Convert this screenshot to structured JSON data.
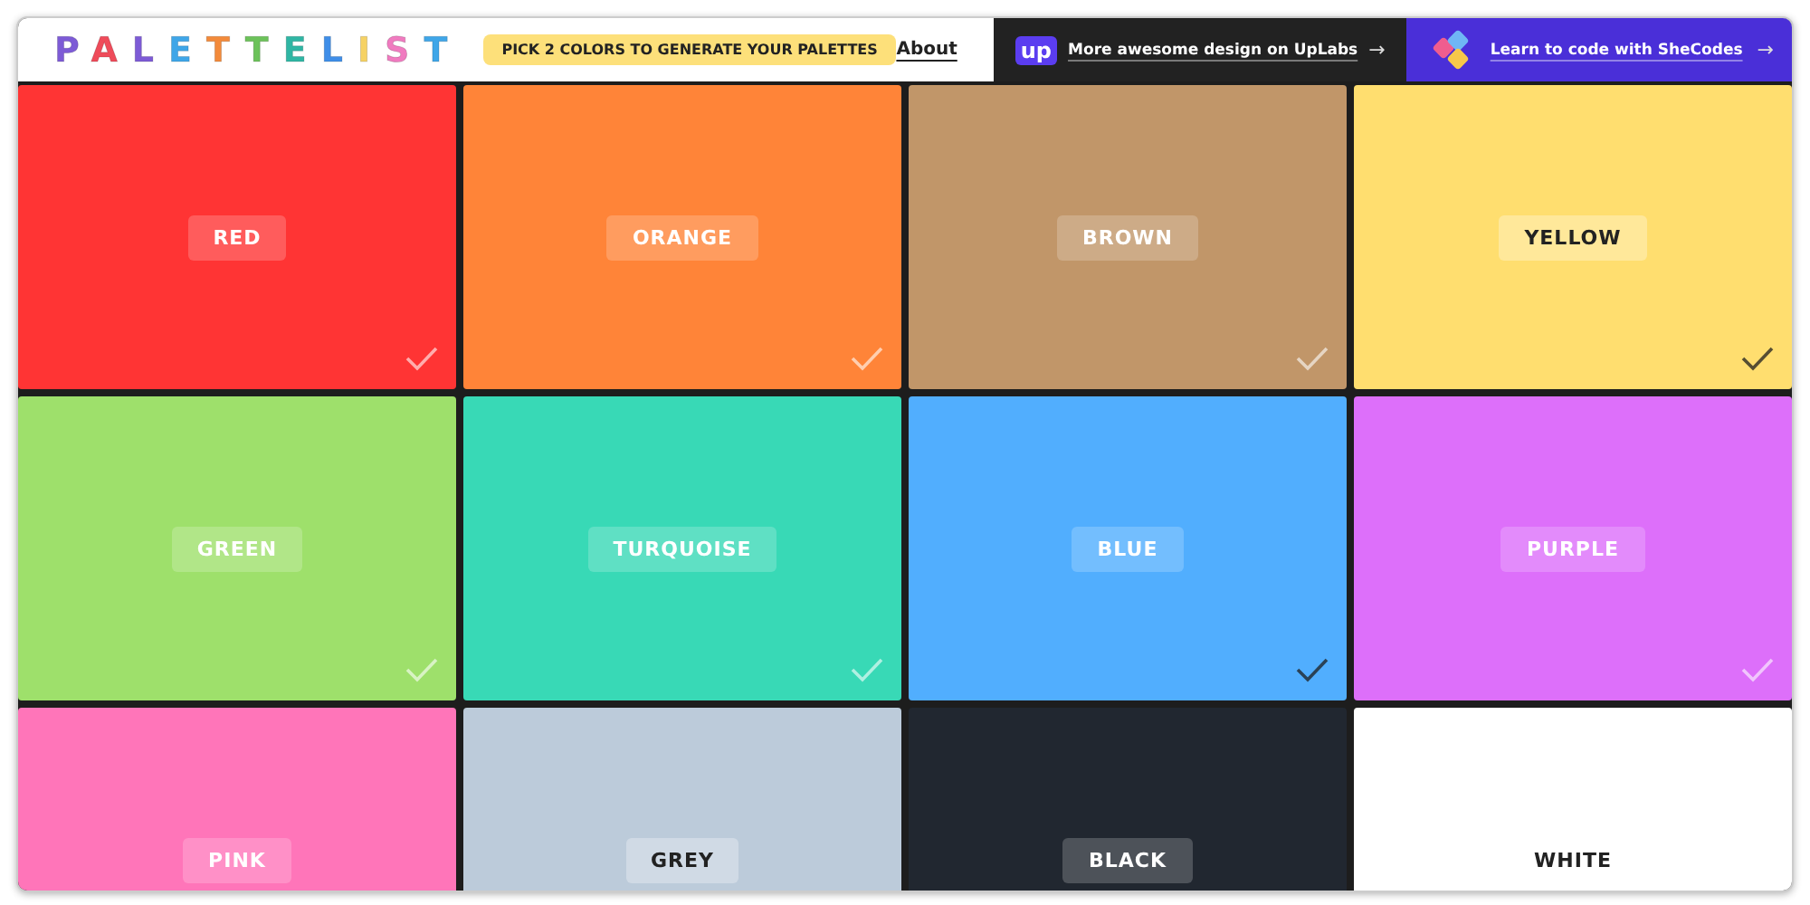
{
  "header": {
    "logo": "PALETTELIST",
    "hint": "PICK 2 COLORS TO GENERATE YOUR PALETTES",
    "about": "About",
    "uplabs_badge": "up",
    "uplabs_link": "More awesome design on UpLabs",
    "shecodes_link": "Learn to code with SheCodes",
    "arrow": "→"
  },
  "colors": [
    {
      "label": "RED",
      "color": "#ff3434",
      "dark_text": false,
      "selected": false
    },
    {
      "label": "ORANGE",
      "color": "#ff8438",
      "dark_text": false,
      "selected": false
    },
    {
      "label": "BROWN",
      "color": "#c19669",
      "dark_text": false,
      "selected": false
    },
    {
      "label": "YELLOW",
      "color": "#ffde6f",
      "dark_text": true,
      "selected": true
    },
    {
      "label": "GREEN",
      "color": "#9ee06b",
      "dark_text": false,
      "selected": false
    },
    {
      "label": "TURQUOISE",
      "color": "#38d9b6",
      "dark_text": false,
      "selected": false
    },
    {
      "label": "BLUE",
      "color": "#51aefe",
      "dark_text": false,
      "selected": true
    },
    {
      "label": "PURPLE",
      "color": "#dd6ffa",
      "dark_text": false,
      "selected": false
    },
    {
      "label": "PINK",
      "color": "#ff75b9",
      "dark_text": false
    },
    {
      "label": "GREY",
      "color": "#bccbda",
      "dark_text": true
    },
    {
      "label": "BLACK",
      "color": "#212730",
      "dark_text": false
    },
    {
      "label": "WHITE",
      "color": "#ffffff",
      "dark_text": true
    }
  ]
}
